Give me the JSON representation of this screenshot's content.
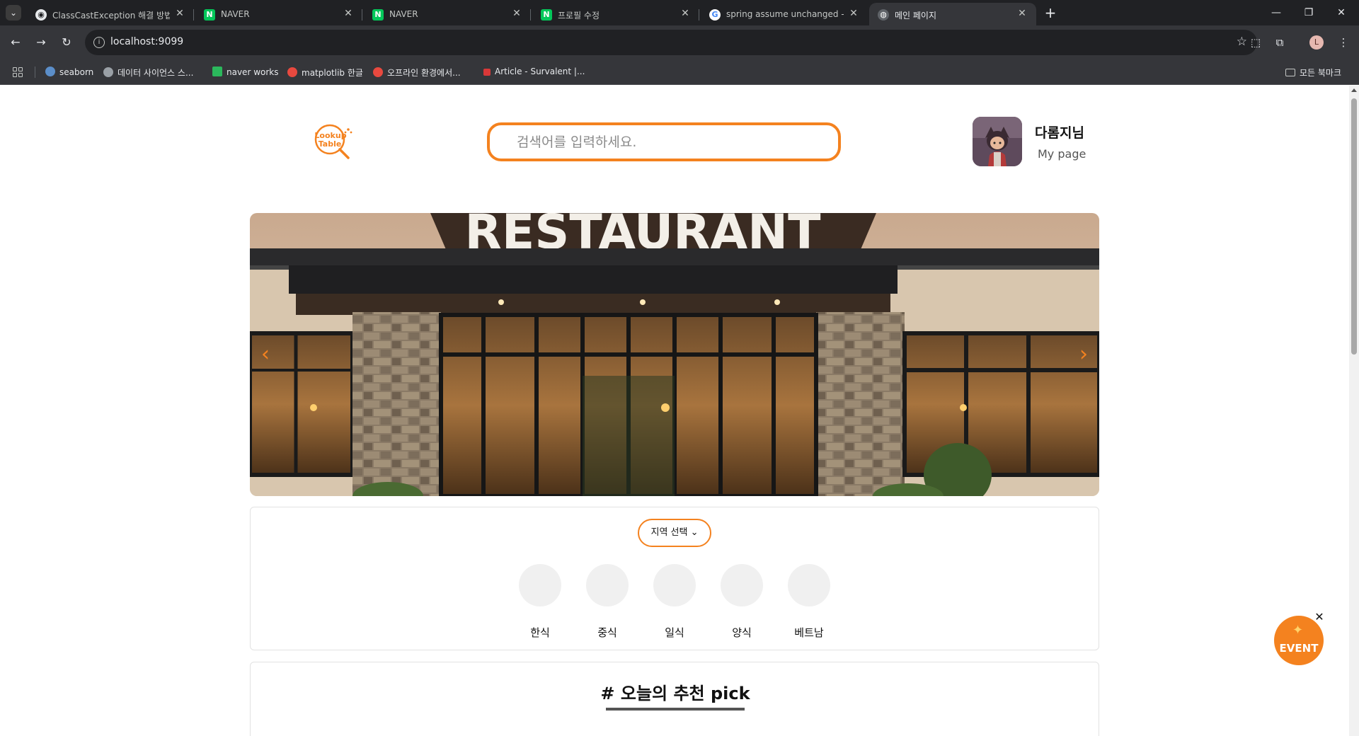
{
  "browser": {
    "tabs": [
      {
        "title": "ClassCastException 해결 방법",
        "favicon": "github-icon"
      },
      {
        "title": "NAVER",
        "favicon": "naver-icon"
      },
      {
        "title": "NAVER",
        "favicon": "naver-icon"
      },
      {
        "title": "프로필 수정",
        "favicon": "naver-icon"
      },
      {
        "title": "spring assume unchanged - G",
        "favicon": "google-icon"
      },
      {
        "title": "메인 페이지",
        "favicon": "globe-icon",
        "active": true
      }
    ],
    "naver_glyph": "N",
    "google_glyph": "G",
    "profile_initial": "L",
    "url": "localhost:9099",
    "bookmarks": [
      {
        "label": "seaborn"
      },
      {
        "label": "데이터 사이언스 스..."
      },
      {
        "label": "naver works"
      },
      {
        "label": "matplotlib 한글"
      },
      {
        "label": "오프라인 환경에서..."
      },
      {
        "label": "Article - Survalent |..."
      }
    ],
    "all_bookmarks_label": "모든 북마크"
  },
  "header": {
    "search_placeholder": "검색어를 입력하세요.",
    "username": "다롬지님",
    "mypage_label": "My page"
  },
  "banner": {
    "sign_text": "RESTAURANT"
  },
  "categories": {
    "region_button": "지역 선택",
    "items": [
      {
        "label": "한식"
      },
      {
        "label": "중식"
      },
      {
        "label": "일식"
      },
      {
        "label": "양식"
      },
      {
        "label": "베트남"
      }
    ]
  },
  "pick": {
    "title": "# 오늘의 추천 pick"
  },
  "event": {
    "label": "EVENT"
  },
  "colors": {
    "accent": "#f4821f",
    "tab_bar": "#202124",
    "toolbar": "#35363a"
  }
}
